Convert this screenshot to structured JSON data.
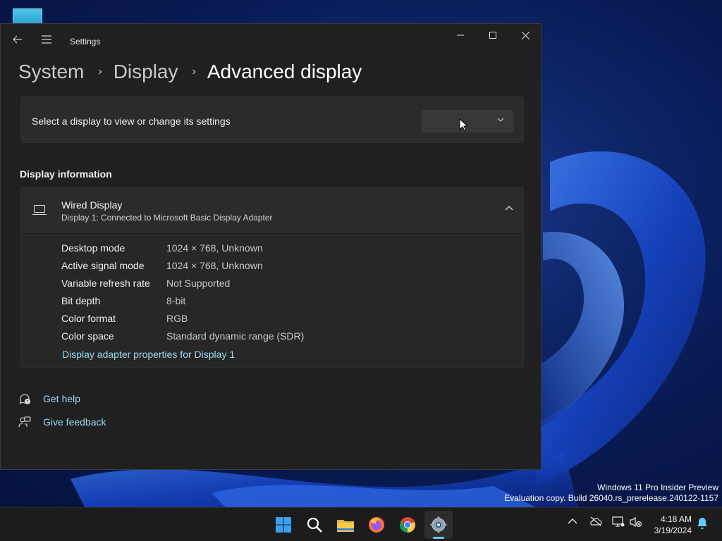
{
  "window": {
    "app_title": "Settings",
    "controls": {
      "minimize": "minimize",
      "maximize": "maximize",
      "close": "close"
    }
  },
  "breadcrumb": {
    "items": [
      "System",
      "Display",
      "Advanced display"
    ]
  },
  "select_display": {
    "label": "Select a display to view or change its settings",
    "selected_value": ""
  },
  "display_information": {
    "section_title": "Display information",
    "name": "Wired Display",
    "subtitle": "Display 1: Connected to Microsoft Basic Display Adapter",
    "rows": [
      {
        "key": "Desktop mode",
        "value": "1024 × 768, Unknown"
      },
      {
        "key": "Active signal mode",
        "value": "1024 × 768, Unknown"
      },
      {
        "key": "Variable refresh rate",
        "value": "Not Supported"
      },
      {
        "key": "Bit depth",
        "value": "8-bit"
      },
      {
        "key": "Color format",
        "value": "RGB"
      },
      {
        "key": "Color space",
        "value": "Standard dynamic range (SDR)"
      }
    ],
    "adapter_link": "Display adapter properties for Display 1"
  },
  "help": {
    "get_help": "Get help",
    "give_feedback": "Give feedback"
  },
  "desktop": {
    "watermark_line1": "Windows 11 Pro Insider Preview",
    "watermark_line2": "Evaluation copy. Build 26040.rs_prerelease.240122-1157"
  },
  "taskbar": {
    "apps": [
      "start-icon",
      "search-icon",
      "file-explorer-icon",
      "firefox-icon",
      "chrome-icon",
      "settings-icon"
    ],
    "active_app": "settings-icon",
    "time": "4:18 AM",
    "date": "3/19/2024"
  },
  "colors": {
    "accent": "#60cdff",
    "link": "#9ad8f5",
    "window_bg": "#202020",
    "card_bg": "#2b2b2b"
  }
}
